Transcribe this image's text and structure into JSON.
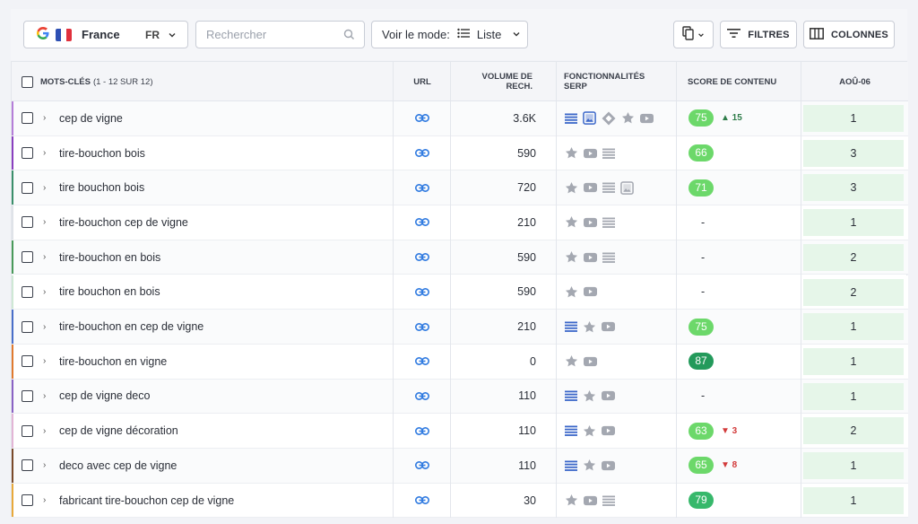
{
  "colors": {
    "badge_light": "#6cd86a",
    "badge_mid": "#37b86b",
    "badge_dark": "#239a5b",
    "link_blue": "#2f7ae0",
    "serp_gray": "#a4a8b1",
    "serp_blue": "#3b67c9",
    "position_bg": "#e6f6e9"
  },
  "toolbar": {
    "engine_icon": "google-g",
    "country": "France",
    "country_code": "FR",
    "search_placeholder": "Rechercher",
    "mode_label": "Voir le mode:",
    "mode_value": "Liste",
    "filters_label": "FILTRES",
    "columns_label": "COLONNES"
  },
  "header": {
    "keywords": "MOTS-CLÉS",
    "keywords_count": "(1 - 12 SUR 12)",
    "url": "URL",
    "volume_line1": "VOLUME DE",
    "volume_line2": "RECH.",
    "features_line1": "FONCTIONNALITÉS",
    "features_line2": "SERP",
    "content_score": "SCORE DE CONTENU",
    "date": "AOÛ-06"
  },
  "rows": [
    {
      "accent": "#b57ed8",
      "keyword": "cep de vigne",
      "volume": "3.6K",
      "serp": [
        "list-blue",
        "image-blue",
        "diamond",
        "star",
        "video"
      ],
      "score": "75",
      "score_color": "#6cd86a",
      "delta": "▲ 15",
      "delta_dir": "up",
      "position": "1"
    },
    {
      "accent": "#8a3fbf",
      "keyword": "tire-bouchon bois",
      "volume": "590",
      "serp": [
        "star",
        "video",
        "list"
      ],
      "score": "66",
      "score_color": "#6cd86a",
      "delta": "",
      "delta_dir": "",
      "position": "3"
    },
    {
      "accent": "#3b8f6b",
      "keyword": "tire bouchon bois",
      "volume": "720",
      "serp": [
        "star",
        "video",
        "list",
        "image"
      ],
      "score": "71",
      "score_color": "#6cd86a",
      "delta": "",
      "delta_dir": "",
      "position": "3"
    },
    {
      "accent": "#dfe3e8",
      "keyword": "tire-bouchon cep de vigne",
      "volume": "210",
      "serp": [
        "star",
        "video",
        "list"
      ],
      "score": "-",
      "score_color": "",
      "delta": "",
      "delta_dir": "",
      "position": "1"
    },
    {
      "accent": "#4a9a5a",
      "keyword": "tire-bouchon en bois",
      "volume": "590",
      "serp": [
        "star",
        "video",
        "list"
      ],
      "score": "-",
      "score_color": "",
      "delta": "",
      "delta_dir": "",
      "position": "2"
    },
    {
      "accent": "#cfe8d5",
      "keyword": "tire bouchon en bois",
      "volume": "590",
      "serp": [
        "star",
        "video"
      ],
      "score": "-",
      "score_color": "",
      "delta": "",
      "delta_dir": "",
      "position": "2"
    },
    {
      "accent": "#4a6fc9",
      "keyword": "tire-bouchon en cep de vigne",
      "volume": "210",
      "serp": [
        "list-blue",
        "star",
        "video"
      ],
      "score": "75",
      "score_color": "#6cd86a",
      "delta": "",
      "delta_dir": "",
      "position": "1"
    },
    {
      "accent": "#e07a2f",
      "keyword": "tire-bouchon en vigne",
      "volume": "0",
      "serp": [
        "star",
        "video"
      ],
      "score": "87",
      "score_color": "#239a5b",
      "delta": "",
      "delta_dir": "",
      "position": "1"
    },
    {
      "accent": "#8a62c4",
      "keyword": "cep de vigne deco",
      "volume": "110",
      "serp": [
        "list-blue",
        "star",
        "video"
      ],
      "score": "-",
      "score_color": "",
      "delta": "",
      "delta_dir": "",
      "position": "1"
    },
    {
      "accent": "#e3b5d6",
      "keyword": "cep de vigne décoration",
      "volume": "110",
      "serp": [
        "list-blue",
        "star",
        "video"
      ],
      "score": "63",
      "score_color": "#6cd86a",
      "delta": "▼ 3",
      "delta_dir": "down",
      "position": "2"
    },
    {
      "accent": "#7a4a2a",
      "keyword": "deco avec cep de vigne",
      "volume": "110",
      "serp": [
        "list-blue",
        "star",
        "video"
      ],
      "score": "65",
      "score_color": "#6cd86a",
      "delta": "▼ 8",
      "delta_dir": "down",
      "position": "1"
    },
    {
      "accent": "#e8a93a",
      "keyword": "fabricant tire-bouchon cep de vigne",
      "volume": "30",
      "serp": [
        "star",
        "video",
        "list"
      ],
      "score": "79",
      "score_color": "#37b86b",
      "delta": "",
      "delta_dir": "",
      "position": "1"
    }
  ]
}
